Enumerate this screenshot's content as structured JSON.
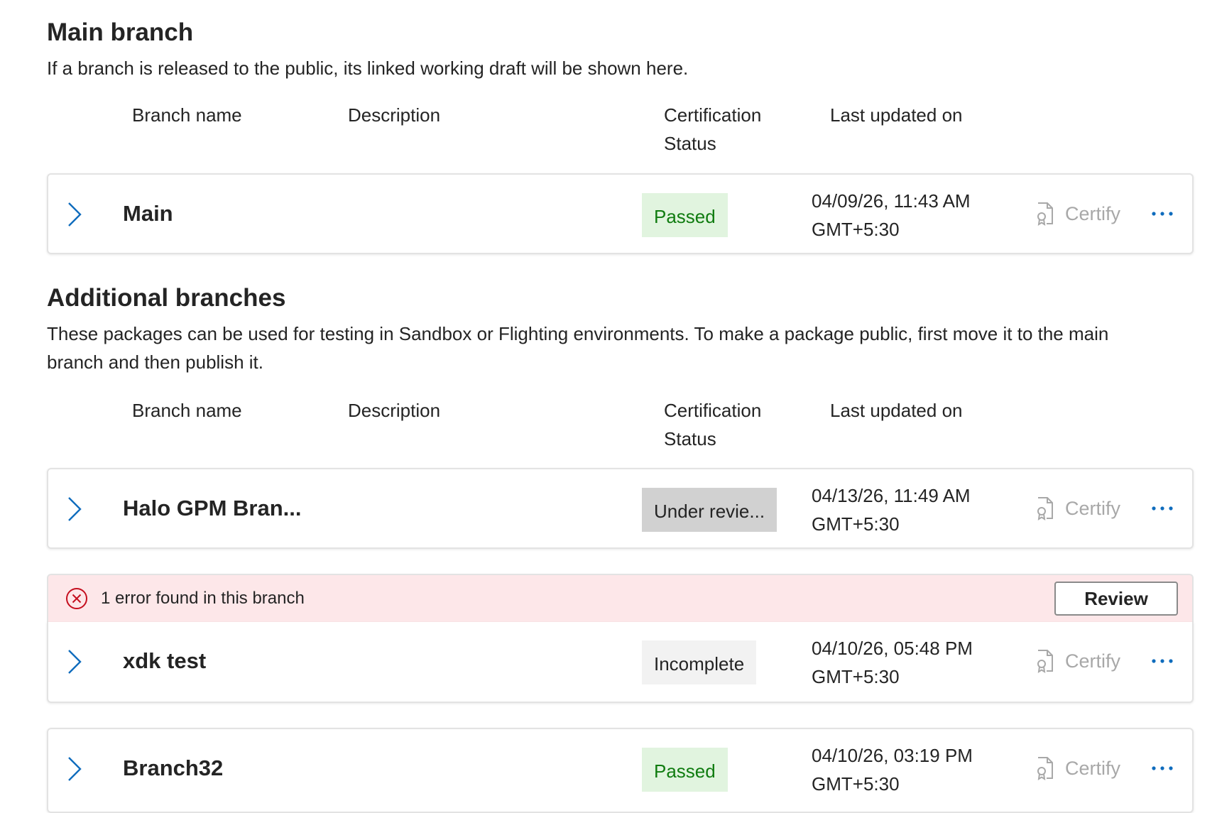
{
  "main_section": {
    "title": "Main branch",
    "description": "If a branch is released to the public, its linked working draft will be shown here."
  },
  "columns": {
    "branch_name": "Branch name",
    "description": "Description",
    "cert_line1": "Certification",
    "cert_line2": "Status",
    "last_updated": "Last updated on"
  },
  "main_branch": {
    "name": "Main",
    "status": "Passed",
    "date": "04/09/26, 11:43 AM",
    "tz": "GMT+5:30",
    "certify": "Certify"
  },
  "additional_section": {
    "title": "Additional branches",
    "description_line1": "These packages can be used for testing in Sandbox or Flighting environments. To make a package public, first move it to the main",
    "description_line2": "branch and then publish it."
  },
  "branches": [
    {
      "name": "Halo GPM Bran...",
      "status": "Under revie...",
      "date": "04/13/26, 11:49 AM",
      "tz": "GMT+5:30",
      "certify": "Certify"
    },
    {
      "name": "xdk test",
      "status": "Incomplete",
      "date": "04/10/26, 05:48 PM",
      "tz": "GMT+5:30",
      "certify": "Certify"
    },
    {
      "name": "Branch32",
      "status": "Passed",
      "date": "04/10/26, 03:19 PM",
      "tz": "GMT+5:30",
      "certify": "Certify"
    }
  ],
  "error_banner": {
    "text": "1 error found in this branch",
    "button": "Review"
  },
  "colors": {
    "accent": "#0f6cbd",
    "passed_bg": "#e1f4df",
    "passed_text": "#107c10",
    "error_bg": "#fde7e9",
    "error_icon": "#c50f1f"
  },
  "icons": {
    "expand": "chevron-right-icon",
    "certify": "certificate-icon",
    "more": "more-horizontal-icon",
    "error": "error-circle-icon"
  }
}
